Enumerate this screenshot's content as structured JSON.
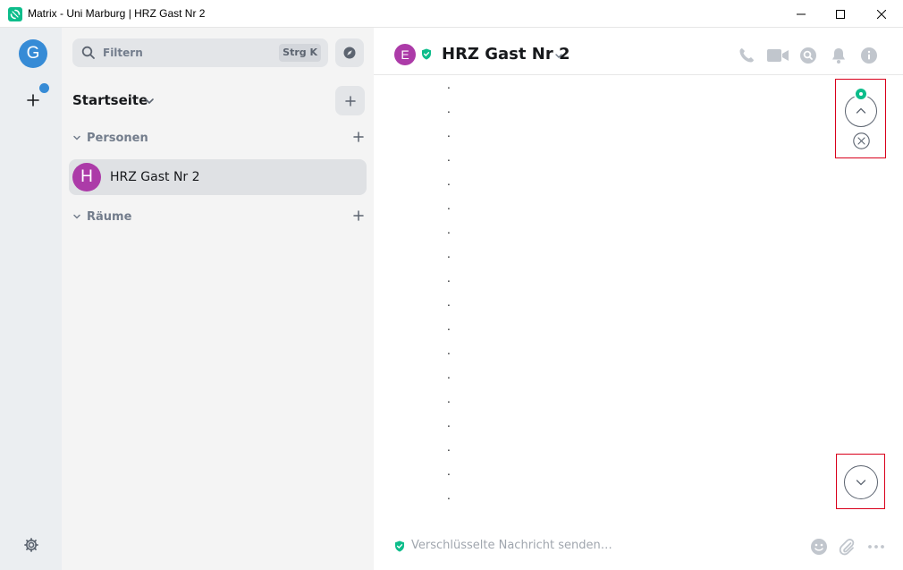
{
  "window": {
    "title": "Matrix - Uni Marburg | HRZ Gast Nr 2",
    "icons": [
      "element-app-icon",
      "minimize-icon",
      "maximize-icon",
      "close-icon"
    ]
  },
  "spaces": {
    "home_avatar_letter": "G",
    "create_space_icon": "plus-icon",
    "settings_icon": "gear-icon",
    "accent": "#368bd6"
  },
  "roomlist": {
    "search_placeholder": "Filtern",
    "search_shortcut": "Strg K",
    "home_label": "Startseite",
    "sections": [
      {
        "label": "Personen"
      },
      {
        "label": "Räume"
      }
    ],
    "rooms": [
      {
        "avatar_letter": "H",
        "name": "HRZ Gast Nr 2",
        "avatar_color": "#ac3ba8"
      }
    ]
  },
  "room": {
    "avatar_letter": "E",
    "title": "HRZ Gast Nr 2",
    "header_icons": [
      "phone-icon",
      "video-icon",
      "search-icon",
      "bell-icon",
      "info-icon"
    ],
    "timeline_dots": [
      ".",
      ".",
      ".",
      ".",
      ".",
      ".",
      ".",
      ".",
      ".",
      ".",
      ".",
      ".",
      ".",
      ".",
      ".",
      ".",
      ".",
      "."
    ]
  },
  "composer": {
    "placeholder": "Verschlüsselte Nachricht senden…",
    "icons": [
      "emoji-icon",
      "attachment-icon",
      "more-options-icon"
    ]
  },
  "colors": {
    "verified_green": "#0dbd8b",
    "highlight_red": "#d9001b"
  }
}
